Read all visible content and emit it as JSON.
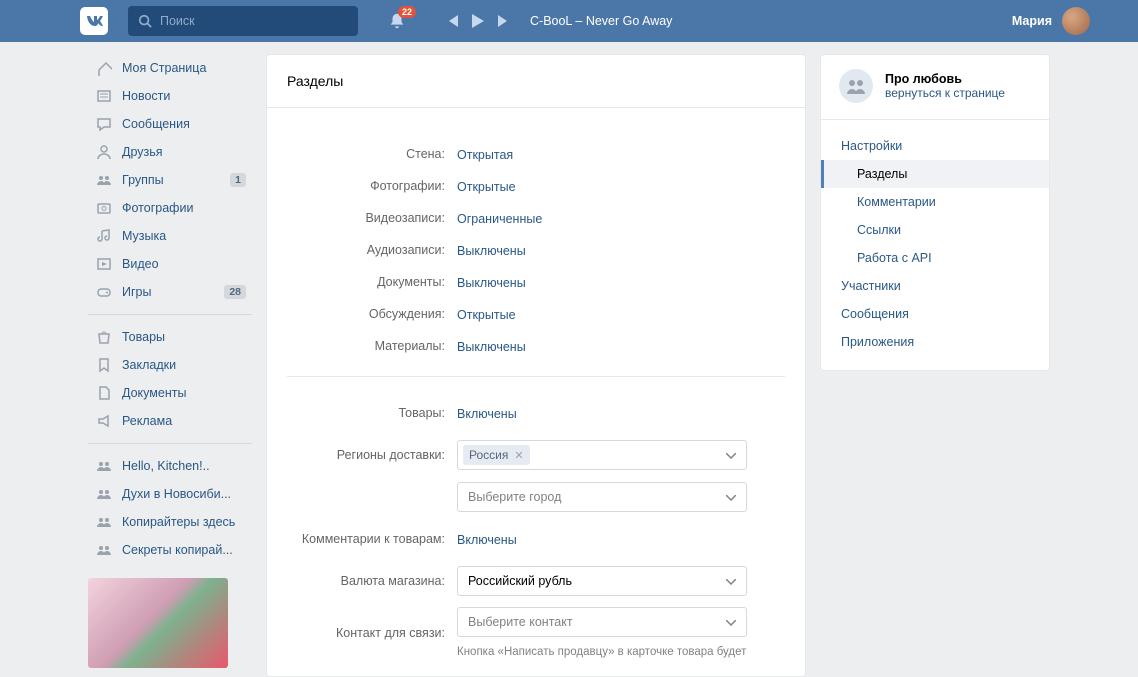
{
  "header": {
    "search_placeholder": "Поиск",
    "notif_count": "22",
    "track": "C-BooL – Never Go Away",
    "username": "Мария"
  },
  "nav": {
    "primary": [
      {
        "icon": "home",
        "label": "Моя Страница"
      },
      {
        "icon": "news",
        "label": "Новости"
      },
      {
        "icon": "msg",
        "label": "Сообщения"
      },
      {
        "icon": "friends",
        "label": "Друзья"
      },
      {
        "icon": "groups",
        "label": "Группы",
        "badge": "1"
      },
      {
        "icon": "photo",
        "label": "Фотографии"
      },
      {
        "icon": "music",
        "label": "Музыка"
      },
      {
        "icon": "video",
        "label": "Видео"
      },
      {
        "icon": "games",
        "label": "Игры",
        "badge": "28"
      }
    ],
    "secondary": [
      {
        "icon": "market",
        "label": "Товары"
      },
      {
        "icon": "bookmark",
        "label": "Закладки"
      },
      {
        "icon": "doc",
        "label": "Документы"
      },
      {
        "icon": "ads",
        "label": "Реклама"
      }
    ],
    "admin": [
      {
        "label": "Hello, Kitchen!.."
      },
      {
        "label": "Духи в Новосиби..."
      },
      {
        "label": "Копирайтеры здесь"
      },
      {
        "label": "Секреты копирай..."
      }
    ]
  },
  "main": {
    "title": "Разделы",
    "rows": [
      {
        "label": "Стена:",
        "value": "Открытая"
      },
      {
        "label": "Фотографии:",
        "value": "Открытые"
      },
      {
        "label": "Видеозаписи:",
        "value": "Ограниченные"
      },
      {
        "label": "Аудиозаписи:",
        "value": "Выключены"
      },
      {
        "label": "Документы:",
        "value": "Выключены"
      },
      {
        "label": "Обсуждения:",
        "value": "Открытые"
      },
      {
        "label": "Материалы:",
        "value": "Выключены"
      }
    ],
    "goods_label": "Товары:",
    "goods_value": "Включены",
    "regions_label": "Регионы доставки:",
    "region_token": "Россия",
    "city_placeholder": "Выберите город",
    "comments_label": "Комментарии к товарам:",
    "comments_value": "Включены",
    "currency_label": "Валюта магазина:",
    "currency_value": "Российский рубль",
    "contact_label": "Контакт для связи:",
    "contact_placeholder": "Выберите контакт",
    "contact_hint": "Кнопка «Написать продавцу» в карточке товара будет"
  },
  "right": {
    "group_name": "Про любовь",
    "group_return": "вернуться к странице",
    "menu": {
      "settings": "Настройки",
      "sections": "Разделы",
      "comments": "Комментарии",
      "links": "Ссылки",
      "api": "Работа с API",
      "members": "Участники",
      "messages": "Сообщения",
      "apps": "Приложения"
    }
  }
}
